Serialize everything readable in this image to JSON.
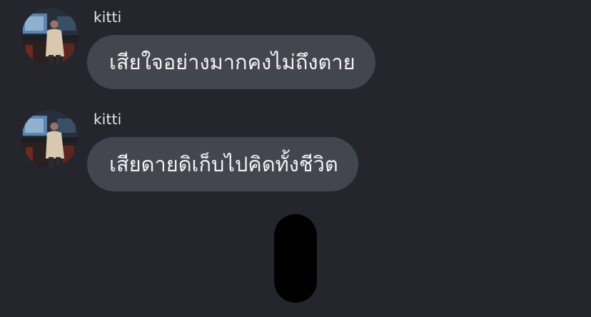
{
  "theme": {
    "background": "#25262d",
    "bubble": "#44464f",
    "text": "#f2f2f4"
  },
  "messages": [
    {
      "sender": "kitti",
      "text": "เสียใจอย่างมากคงไม่ถึงตาย",
      "avatar_icon": "profile-photo"
    },
    {
      "sender": "kitti",
      "text": "เสียดายดิเก็บไปคิดทั้งชีวิต",
      "avatar_icon": "profile-photo"
    }
  ]
}
